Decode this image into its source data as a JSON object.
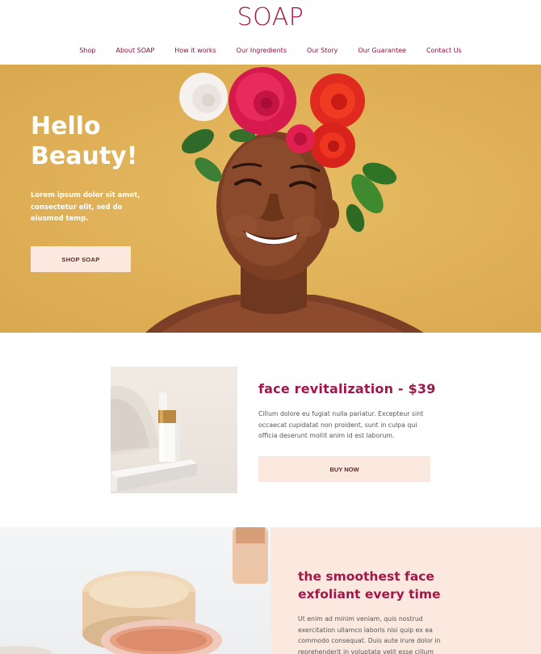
{
  "header": {
    "logo": "SOAP",
    "nav": [
      "Shop",
      "About SOAP",
      "How it works",
      "Our Ingredients",
      "Our Story",
      "Our Guarantee",
      "Contact Us"
    ]
  },
  "hero": {
    "title_line1": "Hello",
    "title_line2": "Beauty!",
    "text": "Lorem ipsum dolor sit amet, consectetur elit, sed do eiusmod temp.",
    "button": "SHOP SOAP"
  },
  "product": {
    "title": "face revitalization - $39",
    "description": "Cillum dolore eu fugiat nulla pariatur. Excepteur sint occaecat cupidatat non proident, sunt in culpa qui officia deserunt mollit anim id est laborum.",
    "button": "BUY NOW"
  },
  "feature": {
    "title": "the smoothest face exfoliant every time",
    "description": "Ut enim ad minim veniam, quis nostrud exercitation ullamco laboris nisi quip ex ea commodo consequat. Duis aute irure dolor in reprehenderit in voluptate velit esse cillum"
  },
  "colors": {
    "brand": "#a3164a",
    "hero_bg": "#e1b35a",
    "button_bg": "#fbe9df"
  }
}
